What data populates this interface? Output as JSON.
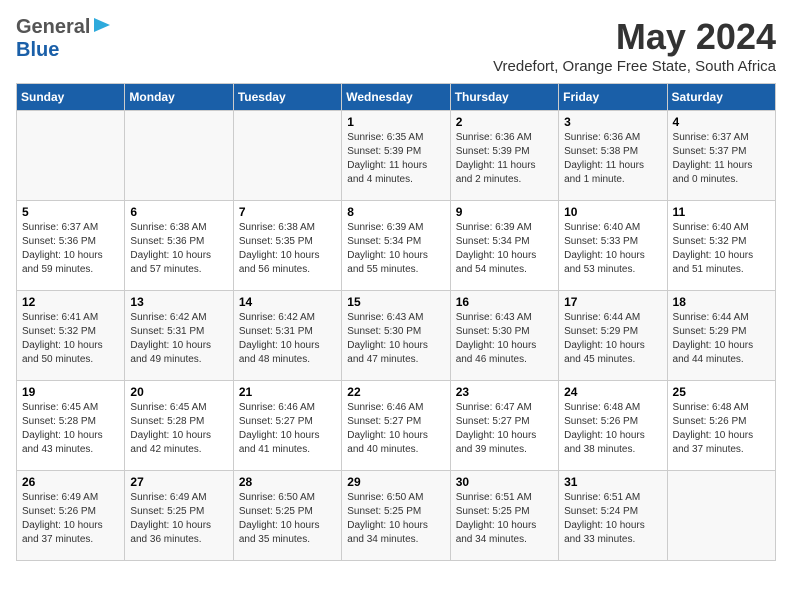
{
  "header": {
    "logo_general": "General",
    "logo_blue": "Blue",
    "month_title": "May 2024",
    "location": "Vredefort, Orange Free State, South Africa"
  },
  "days_of_week": [
    "Sunday",
    "Monday",
    "Tuesday",
    "Wednesday",
    "Thursday",
    "Friday",
    "Saturday"
  ],
  "weeks": [
    [
      {
        "day": "",
        "detail": ""
      },
      {
        "day": "",
        "detail": ""
      },
      {
        "day": "",
        "detail": ""
      },
      {
        "day": "1",
        "detail": "Sunrise: 6:35 AM\nSunset: 5:39 PM\nDaylight: 11 hours\nand 4 minutes."
      },
      {
        "day": "2",
        "detail": "Sunrise: 6:36 AM\nSunset: 5:39 PM\nDaylight: 11 hours\nand 2 minutes."
      },
      {
        "day": "3",
        "detail": "Sunrise: 6:36 AM\nSunset: 5:38 PM\nDaylight: 11 hours\nand 1 minute."
      },
      {
        "day": "4",
        "detail": "Sunrise: 6:37 AM\nSunset: 5:37 PM\nDaylight: 11 hours\nand 0 minutes."
      }
    ],
    [
      {
        "day": "5",
        "detail": "Sunrise: 6:37 AM\nSunset: 5:36 PM\nDaylight: 10 hours\nand 59 minutes."
      },
      {
        "day": "6",
        "detail": "Sunrise: 6:38 AM\nSunset: 5:36 PM\nDaylight: 10 hours\nand 57 minutes."
      },
      {
        "day": "7",
        "detail": "Sunrise: 6:38 AM\nSunset: 5:35 PM\nDaylight: 10 hours\nand 56 minutes."
      },
      {
        "day": "8",
        "detail": "Sunrise: 6:39 AM\nSunset: 5:34 PM\nDaylight: 10 hours\nand 55 minutes."
      },
      {
        "day": "9",
        "detail": "Sunrise: 6:39 AM\nSunset: 5:34 PM\nDaylight: 10 hours\nand 54 minutes."
      },
      {
        "day": "10",
        "detail": "Sunrise: 6:40 AM\nSunset: 5:33 PM\nDaylight: 10 hours\nand 53 minutes."
      },
      {
        "day": "11",
        "detail": "Sunrise: 6:40 AM\nSunset: 5:32 PM\nDaylight: 10 hours\nand 51 minutes."
      }
    ],
    [
      {
        "day": "12",
        "detail": "Sunrise: 6:41 AM\nSunset: 5:32 PM\nDaylight: 10 hours\nand 50 minutes."
      },
      {
        "day": "13",
        "detail": "Sunrise: 6:42 AM\nSunset: 5:31 PM\nDaylight: 10 hours\nand 49 minutes."
      },
      {
        "day": "14",
        "detail": "Sunrise: 6:42 AM\nSunset: 5:31 PM\nDaylight: 10 hours\nand 48 minutes."
      },
      {
        "day": "15",
        "detail": "Sunrise: 6:43 AM\nSunset: 5:30 PM\nDaylight: 10 hours\nand 47 minutes."
      },
      {
        "day": "16",
        "detail": "Sunrise: 6:43 AM\nSunset: 5:30 PM\nDaylight: 10 hours\nand 46 minutes."
      },
      {
        "day": "17",
        "detail": "Sunrise: 6:44 AM\nSunset: 5:29 PM\nDaylight: 10 hours\nand 45 minutes."
      },
      {
        "day": "18",
        "detail": "Sunrise: 6:44 AM\nSunset: 5:29 PM\nDaylight: 10 hours\nand 44 minutes."
      }
    ],
    [
      {
        "day": "19",
        "detail": "Sunrise: 6:45 AM\nSunset: 5:28 PM\nDaylight: 10 hours\nand 43 minutes."
      },
      {
        "day": "20",
        "detail": "Sunrise: 6:45 AM\nSunset: 5:28 PM\nDaylight: 10 hours\nand 42 minutes."
      },
      {
        "day": "21",
        "detail": "Sunrise: 6:46 AM\nSunset: 5:27 PM\nDaylight: 10 hours\nand 41 minutes."
      },
      {
        "day": "22",
        "detail": "Sunrise: 6:46 AM\nSunset: 5:27 PM\nDaylight: 10 hours\nand 40 minutes."
      },
      {
        "day": "23",
        "detail": "Sunrise: 6:47 AM\nSunset: 5:27 PM\nDaylight: 10 hours\nand 39 minutes."
      },
      {
        "day": "24",
        "detail": "Sunrise: 6:48 AM\nSunset: 5:26 PM\nDaylight: 10 hours\nand 38 minutes."
      },
      {
        "day": "25",
        "detail": "Sunrise: 6:48 AM\nSunset: 5:26 PM\nDaylight: 10 hours\nand 37 minutes."
      }
    ],
    [
      {
        "day": "26",
        "detail": "Sunrise: 6:49 AM\nSunset: 5:26 PM\nDaylight: 10 hours\nand 37 minutes."
      },
      {
        "day": "27",
        "detail": "Sunrise: 6:49 AM\nSunset: 5:25 PM\nDaylight: 10 hours\nand 36 minutes."
      },
      {
        "day": "28",
        "detail": "Sunrise: 6:50 AM\nSunset: 5:25 PM\nDaylight: 10 hours\nand 35 minutes."
      },
      {
        "day": "29",
        "detail": "Sunrise: 6:50 AM\nSunset: 5:25 PM\nDaylight: 10 hours\nand 34 minutes."
      },
      {
        "day": "30",
        "detail": "Sunrise: 6:51 AM\nSunset: 5:25 PM\nDaylight: 10 hours\nand 34 minutes."
      },
      {
        "day": "31",
        "detail": "Sunrise: 6:51 AM\nSunset: 5:24 PM\nDaylight: 10 hours\nand 33 minutes."
      },
      {
        "day": "",
        "detail": ""
      }
    ]
  ]
}
